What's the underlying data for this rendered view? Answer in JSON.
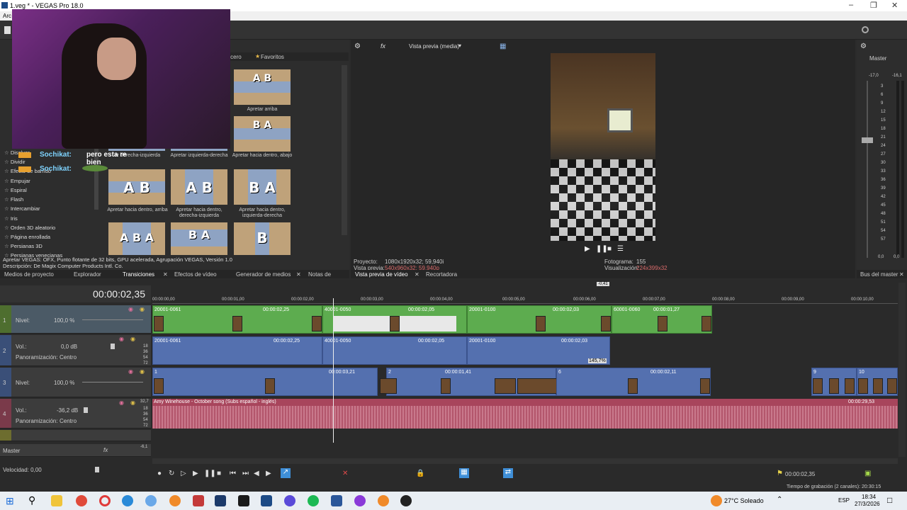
{
  "window": {
    "title": "1.veg * - VEGAS Pro 18.0"
  },
  "menu": {
    "first": "Arc"
  },
  "chat": [
    {
      "user": "Sochikat:",
      "text": "pero esta re bien"
    },
    {
      "user": "Sochikat:",
      "text": ""
    }
  ],
  "transitions_list": [
    "Disolver",
    "Dividir",
    "Efecto de barrido",
    "Empujar",
    "Espiral",
    "Flash",
    "Intercambiar",
    "Iris",
    "Orden 3D aleatorio",
    "Página enrollada",
    "Persianas 3D",
    "Persianas venecianas"
  ],
  "panel_tabs": {
    "tercero": "ercero",
    "favoritos": "Favoritos"
  },
  "thumbnails": [
    {
      "label": "Apretar arriba",
      "glyph": "A B"
    },
    {
      "label": "",
      "glyph": "B A"
    },
    {
      "label": "ar derecha-izquierda",
      "glyph": ""
    },
    {
      "label": "Apretar izquierda-derecha",
      "glyph": ""
    },
    {
      "label": "Apretar hacia dentro, abajo",
      "glyph": ""
    },
    {
      "label": "Apretar hacia dentro, arriba",
      "glyph": "A B"
    },
    {
      "label": "Apretar hacia dentro, derecha-izquierda",
      "glyph": "A B"
    },
    {
      "label": "Apretar hacia dentro, izquierda-derecha",
      "glyph": "B A"
    },
    {
      "label": "",
      "glyph": "A B A"
    },
    {
      "label": "",
      "glyph": "B A"
    },
    {
      "label": "",
      "glyph": "B"
    }
  ],
  "description": {
    "line1": "Apretar VEGAS: OFX, Punto flotante de 32 bits, GPU acelerada, Agrupación VEGAS, Versión 1.0",
    "line2": "Descripción: De Magix Computer Products Intl. Co."
  },
  "bottom_tabs_left": [
    "Medios de proyecto",
    "Explorador",
    "Transiciones",
    "Efectos de vídeo",
    "Generador de medios",
    "Notas de"
  ],
  "preview": {
    "toolbar_label": "Vista previa (media)",
    "proyecto_label": "Proyecto:",
    "proyecto_value": "1080x1920x32; 59,940i",
    "vista_label": "Vista previa:",
    "vista_value": "540x960x32; 59,940p",
    "fotograma_label": "Fotograma:",
    "fotograma_value": "155",
    "visualizacion_label": "Visualización:",
    "visualizacion_value": "224x399x32",
    "tab1": "Vista previa de vídeo",
    "tab2": "Recortadora"
  },
  "master": {
    "title": "Master",
    "peak_l": "-17,0",
    "peak_r": "-16,1",
    "scale": [
      "3",
      "6",
      "9",
      "12",
      "15",
      "18",
      "21",
      "24",
      "27",
      "30",
      "33",
      "36",
      "39",
      "42",
      "45",
      "48",
      "51",
      "54",
      "57"
    ],
    "bottom_l": "0,0",
    "bottom_r": "0,0",
    "tab": "Bus del master"
  },
  "timeline": {
    "timecode": "00:00:02,35",
    "marker": "-0,41",
    "ruler": [
      "00:00:00,00",
      "00:00:01,00",
      "00:00:02,00",
      "00:00:03,00",
      "00:00:04,00",
      "00:00:05,00",
      "00:00:06,00",
      "00:00:07,00",
      "00:00:08,00",
      "00:00:09,00",
      "00:00:10,00"
    ],
    "tracks": {
      "t1": {
        "num": "1",
        "label": "Nivel:",
        "value": "100,0 %"
      },
      "t2": {
        "num": "2",
        "vol_label": "Vol.:",
        "vol_value": "0,0 dB",
        "pan_label": "Panoramización:",
        "pan_value": "Centro"
      },
      "t3": {
        "num": "3",
        "label": "Nivel:",
        "value": "100,0 %"
      },
      "t4": {
        "num": "4",
        "vol_label": "Vol.:",
        "vol_value": "-36,2 dB",
        "pan_label": "Panoramización:",
        "pan_value": "Centro",
        "peak": "32,7"
      },
      "master_label": "Master",
      "master_peak": "-6,1"
    },
    "db_scale": [
      "18",
      "36",
      "54",
      "72"
    ],
    "clips_v1": [
      {
        "name": "20001-0061",
        "dur": "00:00:02,25"
      },
      {
        "name": "40001-0050",
        "dur": "00:00:02,05"
      },
      {
        "name": "20001-0100",
        "dur": "00:00:02,03"
      },
      {
        "name": "60001-0060",
        "dur": "00:00:01,27"
      }
    ],
    "clips_a2": [
      {
        "name": "20001-0061",
        "dur": "00:00:02,25"
      },
      {
        "name": "40001-0050",
        "dur": "00:00:02,05"
      },
      {
        "name": "20001-0100",
        "dur": "00:00:02,03",
        "pct": "145,7%"
      }
    ],
    "clips_v3": [
      {
        "name": "1",
        "dur": "00:00:03,21"
      },
      {
        "name": "2",
        "dur": "00:00:01,41"
      },
      {
        "name": "6",
        "dur": "00:00:02,11"
      },
      {
        "name": "9",
        "dur": ""
      },
      {
        "name": "10",
        "dur": ""
      }
    ],
    "music": {
      "name": "Amy Winehouse - October song (Subs español - inglés)",
      "dur": "00:00:29,53"
    },
    "velocidad": "Velocidad: 0,00",
    "cursor_tc": "00:00:02,35",
    "recording": "Tiempo de grabación (2 canales): 20:30:15"
  },
  "taskbar": {
    "weather": "27°C Soleado",
    "lang": "ESP",
    "time": "18:34",
    "date": "27/3/2026"
  },
  "colors": {
    "video_clip": "#5dac4f",
    "audio_clip": "#5571b0",
    "music_clip": "#a8455c",
    "accent": "#3f8fd8"
  }
}
